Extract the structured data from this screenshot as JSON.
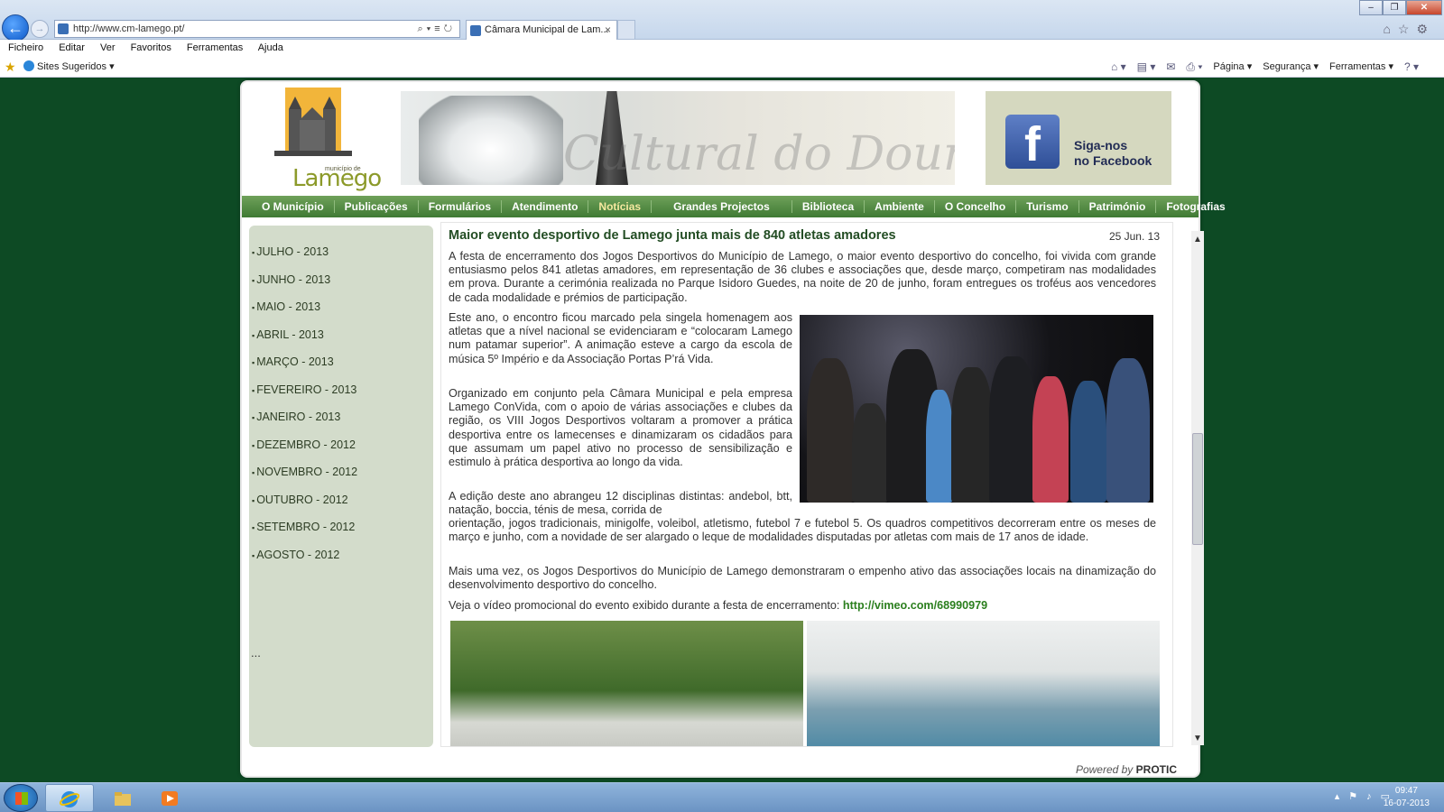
{
  "browser": {
    "address": "http://www.cm-lamego.pt/",
    "tab_title": "Câmara Municipal de Lam...",
    "tab_close": "×",
    "menu": [
      "Ficheiro",
      "Editar",
      "Ver",
      "Favoritos",
      "Ferramentas",
      "Ajuda"
    ],
    "suggested_sites": "Sites Sugeridos",
    "cmd": {
      "page": "Página",
      "security": "Segurança",
      "tools": "Ferramentas"
    }
  },
  "header": {
    "logo_small": "município de",
    "logo_name": "Lamego",
    "banner_watermark": "Cultural do Douro",
    "facebook_text_1": "Siga-nos",
    "facebook_text_2": "no Facebook"
  },
  "nav": [
    "O Município",
    "Publicações",
    "Formulários",
    "Atendimento",
    "Notícias",
    "Grandes Projectos",
    "Biblioteca",
    "Ambiente",
    "O Concelho",
    "Turismo",
    "Património",
    "Fotografias"
  ],
  "sidebar": {
    "months": [
      "JULHO - 2013",
      "JUNHO - 2013",
      "MAIO - 2013",
      "ABRIL - 2013",
      "MARÇO - 2013",
      "FEVEREIRO - 2013",
      "JANEIRO - 2013",
      "DEZEMBRO - 2012",
      "NOVEMBRO - 2012",
      "OUTUBRO - 2012",
      "SETEMBRO - 2012",
      "AGOSTO - 2012"
    ],
    "more": "..."
  },
  "article": {
    "title": "Maior evento desportivo de Lamego junta mais de 840 atletas amadores",
    "date": "25 Jun. 13",
    "p1": "A festa de encerramento dos Jogos Desportivos do Município de Lamego, o maior evento desportivo do concelho, foi vivida com grande entusiasmo pelos 841 atletas amadores, em representação de 36 clubes e associações que, desde março, competiram nas modalidades em prova. Durante a cerimónia realizada no Parque Isidoro Guedes, na noite de 20 de junho, foram entregues os troféus aos vencedores de cada modalidade e prémios de participação.",
    "p2": "Este ano, o encontro ficou marcado pela singela homenagem aos atletas que a nível nacional se evidenciaram e “colocaram Lamego num patamar superior”. A animação esteve a cargo da escola de música 5º Império e da Associação Portas P’rá Vida.",
    "p3": "Organizado em conjunto pela Câmara Municipal e pela empresa Lamego ConVida, com o apoio de várias associações e clubes da região, os VIII Jogos Desportivos voltaram a promover a prática desportiva entre os lamecenses e dinamizaram os cidadãos para que assumam um papel ativo no processo de sensibilização e estimulo à prática desportiva ao longo da vida.",
    "p4a": "A edição deste ano abrangeu 12 disciplinas distintas: andebol, btt, natação, boccia, ténis de mesa, corrida de",
    "p4b": "orientação, jogos tradicionais, minigolfe, voleibol, atletismo, futebol 7 e futebol 5. Os quadros competitivos decorreram entre os meses de março e junho, com a novidade de ser alargado o leque de modalidades disputadas por atletas com mais de 17 anos de idade.",
    "p5": "Mais uma vez, os Jogos Desportivos do Município de Lamego demonstraram o empenho ativo das associações locais na dinamização do desenvolvimento desportivo do concelho.",
    "p6_text": "Veja o vídeo promocional do evento exibido durante a festa de encerramento:",
    "p6_link": "http://vimeo.com/68990979"
  },
  "footer": {
    "powered_prefix": "Powered by",
    "powered_brand": "PROTIC"
  },
  "taskbar": {
    "time": "09:47",
    "date": "16-07-2013"
  },
  "colors": {
    "page_bg": "#0d4a24",
    "nav_green": "#4f8a40",
    "sidebar_bg": "#d3dccb",
    "title_green": "#234d24"
  }
}
